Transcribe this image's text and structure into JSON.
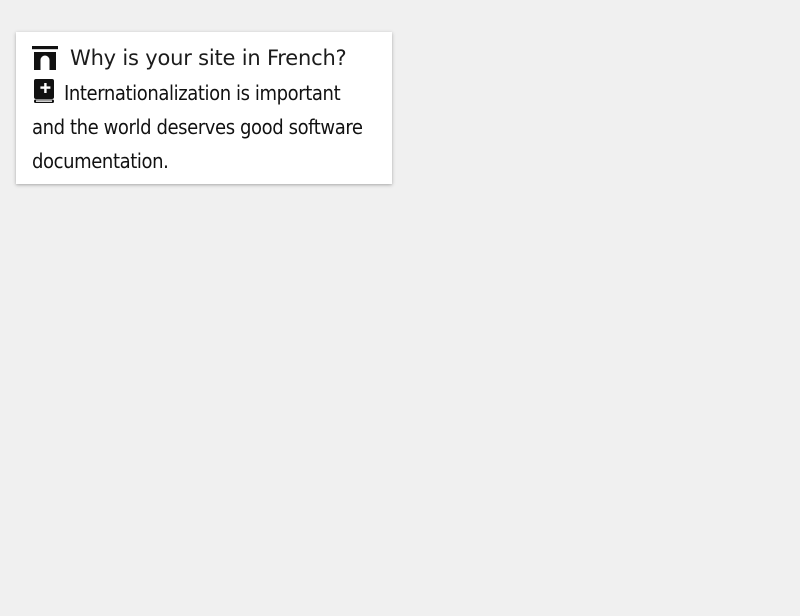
{
  "faq": {
    "question": "Why is your site in French?",
    "question_icon": "arch-icon",
    "answer_icon": "book-icon",
    "answer": "Internationalization is important and the world deserves good software documentation."
  }
}
